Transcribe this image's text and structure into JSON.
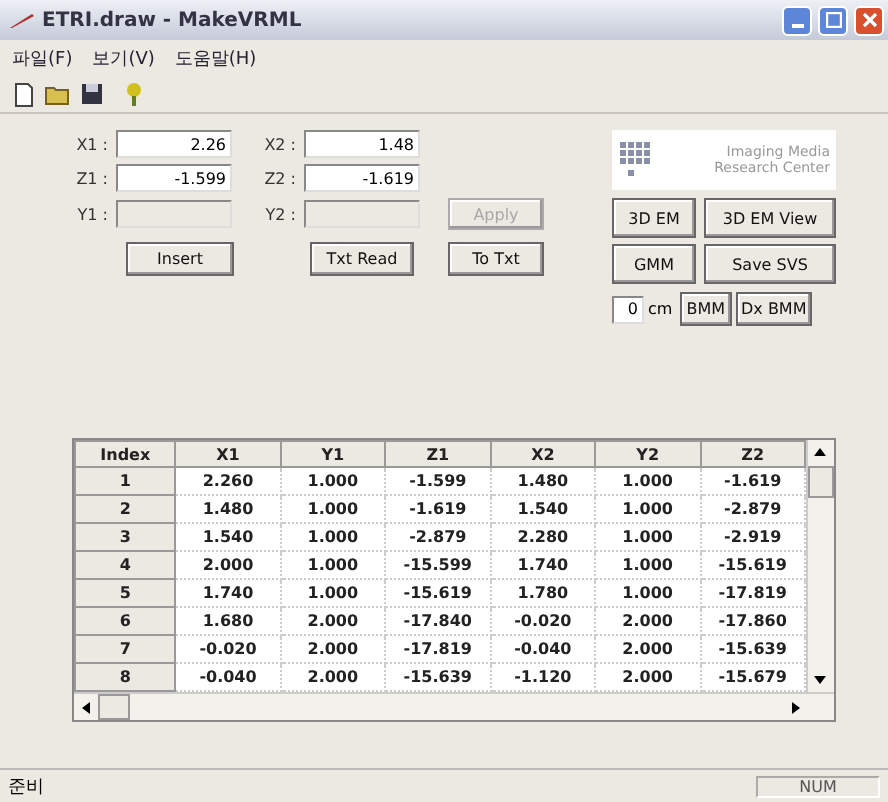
{
  "window": {
    "title": "ETRI.draw - MakeVRML"
  },
  "menu": [
    "파일(F)",
    "보기(V)",
    "도움말(H)"
  ],
  "toolbar": [
    {
      "kind": "new"
    },
    {
      "kind": "open"
    },
    {
      "kind": "save"
    },
    {
      "kind": "help"
    }
  ],
  "fields": [
    {
      "label": "X1 :",
      "value": "2.26",
      "disabled": false
    },
    {
      "label": "X2 :",
      "value": "1.48",
      "disabled": false
    },
    {
      "label": "Z1 :",
      "value": "-1.599",
      "disabled": false
    },
    {
      "label": "Z2 :",
      "value": "-1.619",
      "disabled": false
    },
    {
      "label": "Y1 :",
      "disabled": true
    },
    {
      "label": "Y2 :",
      "disabled": true
    }
  ],
  "left_buttons": [
    {
      "label": "Apply",
      "disabled": true
    },
    {
      "label": "Insert",
      "disabled": false
    },
    {
      "label": "Txt Read",
      "disabled": false
    },
    {
      "label": "To Txt",
      "disabled": false
    }
  ],
  "logo": {
    "line_1": "Imaging Media",
    "line_2": "Research Center"
  },
  "right_buttons": [
    {
      "label": "3D EM"
    },
    {
      "label": "3D EM View"
    },
    {
      "label": "GMM"
    },
    {
      "label": "Save SVS"
    }
  ],
  "size": {
    "value": "0",
    "unit": "cm"
  },
  "bottom_buttons": [
    {
      "label": "BMM"
    },
    {
      "label": "Dx BMM"
    }
  ],
  "table": {
    "columns": [
      "Index",
      "X1",
      "Y1",
      "Z1",
      "X2",
      "Y2",
      "Z2"
    ],
    "rows": [
      [
        "1",
        "2.260",
        "1.000",
        "-1.599",
        "1.480",
        "1.000",
        "-1.619"
      ],
      [
        "2",
        "1.480",
        "1.000",
        "-1.619",
        "1.540",
        "1.000",
        "-2.879"
      ],
      [
        "3",
        "1.540",
        "1.000",
        "-2.879",
        "2.280",
        "1.000",
        "-2.919"
      ],
      [
        "4",
        "2.000",
        "1.000",
        "-15.599",
        "1.740",
        "1.000",
        "-15.619"
      ],
      [
        "5",
        "1.740",
        "1.000",
        "-15.619",
        "1.780",
        "1.000",
        "-17.819"
      ],
      [
        "6",
        "1.680",
        "2.000",
        "-17.840",
        "-0.020",
        "2.000",
        "-17.860"
      ],
      [
        "7",
        "-0.020",
        "2.000",
        "-17.819",
        "-0.040",
        "2.000",
        "-15.639"
      ],
      [
        "8",
        "-0.040",
        "2.000",
        "-15.639",
        "-1.120",
        "2.000",
        "-15.679"
      ]
    ]
  },
  "status_bar": {
    "message": "준비",
    "indicator": "NUM"
  }
}
